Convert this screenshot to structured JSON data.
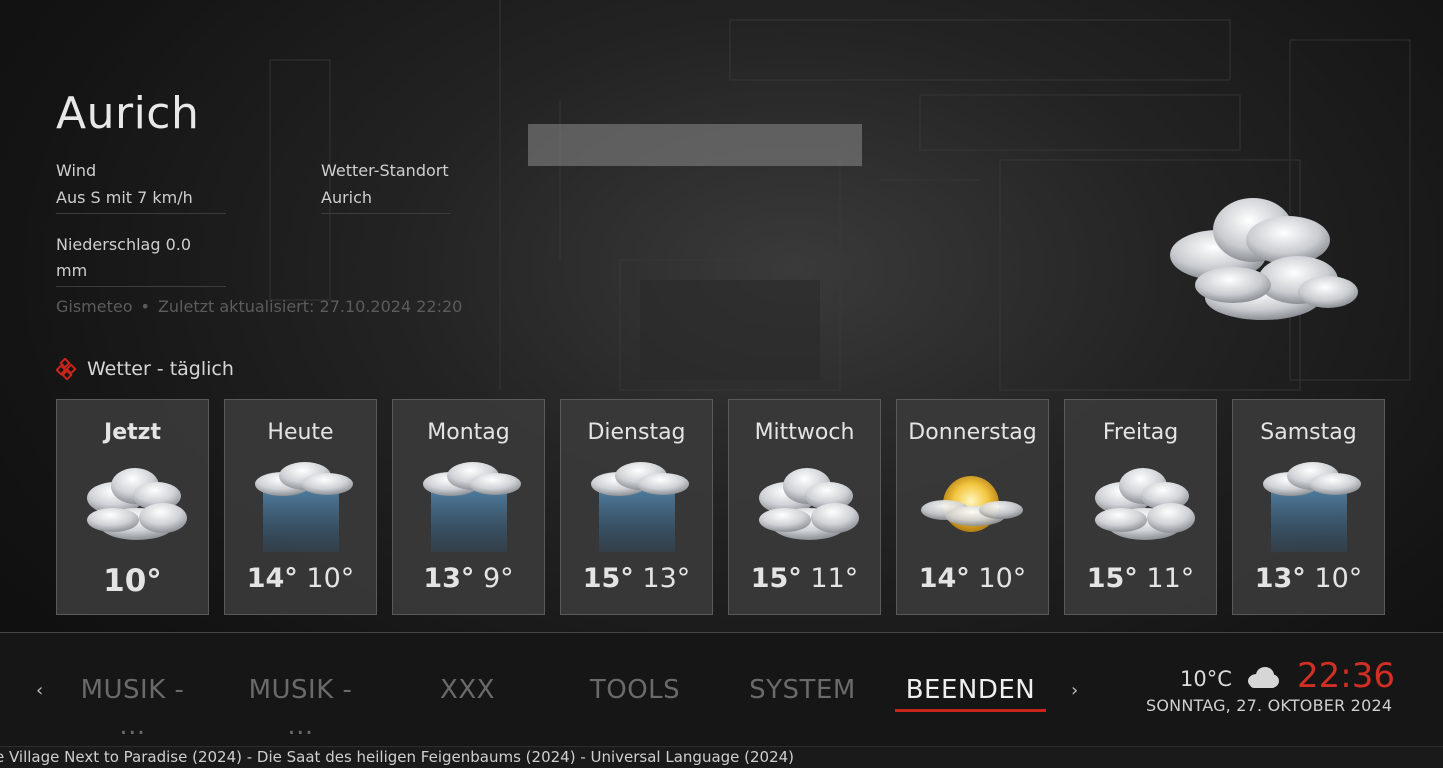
{
  "location": {
    "title": "Aurich"
  },
  "wind": {
    "label": "Wind",
    "value": "Aus S mit 7 km/h"
  },
  "weather_location": {
    "label": "Wetter-Standort",
    "value": "Aurich"
  },
  "precipitation": {
    "text": "Niederschlag 0.0 mm"
  },
  "source": {
    "provider": "Gismeteo",
    "separator": "•",
    "updated": "Zuletzt aktualisiert: 27.10.2024 22:20"
  },
  "current_icon": "cloudy-icon",
  "section": {
    "title": "Wetter - täglich",
    "icon": "weather-section-icon"
  },
  "days": [
    {
      "name": "Jetzt",
      "icon": "cloudy-icon",
      "temp": "10°"
    },
    {
      "name": "Heute",
      "icon": "rain-icon",
      "high": "14°",
      "low": "10°"
    },
    {
      "name": "Montag",
      "icon": "rain-icon",
      "high": "13°",
      "low": "9°"
    },
    {
      "name": "Dienstag",
      "icon": "rain-icon",
      "high": "15°",
      "low": "13°"
    },
    {
      "name": "Mittwoch",
      "icon": "cloudy-icon",
      "high": "15°",
      "low": "11°"
    },
    {
      "name": "Donnerstag",
      "icon": "partly-sunny-icon",
      "high": "14°",
      "low": "10°"
    },
    {
      "name": "Freitag",
      "icon": "cloudy-icon",
      "high": "15°",
      "low": "11°"
    },
    {
      "name": "Samstag",
      "icon": "rain-icon",
      "high": "13°",
      "low": "10°"
    }
  ],
  "menu": {
    "prev_arrow": "‹",
    "next_arrow": "›",
    "items": [
      {
        "label": "MUSIK - ..."
      },
      {
        "label": "MUSIK - ..."
      },
      {
        "label": "XXX"
      },
      {
        "label": "TOOLS"
      },
      {
        "label": "SYSTEM"
      },
      {
        "label": "BEENDEN",
        "active": true
      }
    ]
  },
  "status": {
    "temperature": "10°C",
    "weather_icon": "cloud-icon",
    "time": "22:36",
    "date": "SONNTAG, 27. OKTOBER 2024"
  },
  "ticker": {
    "text": "e Village Next to Paradise (2024) - Die Saat des heiligen Feigenbaums (2024) - Universal Language (2024)"
  },
  "colors": {
    "accent": "#d22f24",
    "card_bg": "#3a3a3a",
    "text_dim": "#6a6a6a"
  }
}
